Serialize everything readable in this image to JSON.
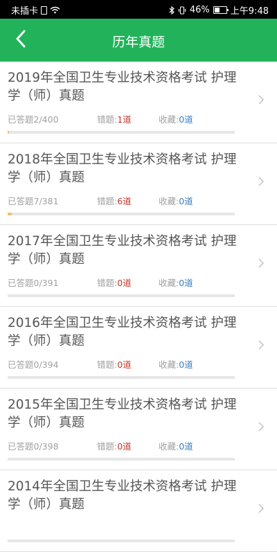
{
  "status_bar": {
    "carrier": "未插卡",
    "battery": "46%",
    "battery_level": 0.46,
    "time": "上午9:48"
  },
  "header": {
    "title": "历年真题",
    "back_icon": "chevron-left-icon"
  },
  "exams": [
    {
      "title": "2019年全国卫生专业技术资格考试 护理学（师）真题",
      "answered_label": "已答题",
      "answered": "2/400",
      "progress": 0.005,
      "wrong_label": "错题:",
      "wrong": "1道",
      "fav_label": "收藏:",
      "fav": "0道"
    },
    {
      "title": "2018年全国卫生专业技术资格考试 护理学（师）真题",
      "answered_label": "已答题",
      "answered": "7/381",
      "progress": 0.018,
      "wrong_label": "错题:",
      "wrong": "6道",
      "fav_label": "收藏:",
      "fav": "0道"
    },
    {
      "title": "2017年全国卫生专业技术资格考试 护理学（师）真题",
      "answered_label": "已答题",
      "answered": "0/391",
      "progress": 0,
      "wrong_label": "错题:",
      "wrong": "0道",
      "fav_label": "收藏:",
      "fav": "0道"
    },
    {
      "title": "2016年全国卫生专业技术资格考试 护理学（师）真题",
      "answered_label": "已答题",
      "answered": "0/394",
      "progress": 0,
      "wrong_label": "错题:",
      "wrong": "0道",
      "fav_label": "收藏:",
      "fav": "0道"
    },
    {
      "title": "2015年全国卫生专业技术资格考试 护理学（师）真题",
      "answered_label": "已答题",
      "answered": "0/398",
      "progress": 0,
      "wrong_label": "错题:",
      "wrong": "0道",
      "fav_label": "收藏:",
      "fav": "0道"
    },
    {
      "title": "2014年全国卫生专业技术资格考试 护理学（师）真题",
      "answered_label": "",
      "answered": "",
      "progress": 0,
      "wrong_label": "",
      "wrong": "",
      "fav_label": "",
      "fav": ""
    }
  ],
  "colors": {
    "accent": "#22b35a",
    "wrong": "#c0392b",
    "favorite": "#3a7fc2",
    "progress": "#f5c26b"
  }
}
